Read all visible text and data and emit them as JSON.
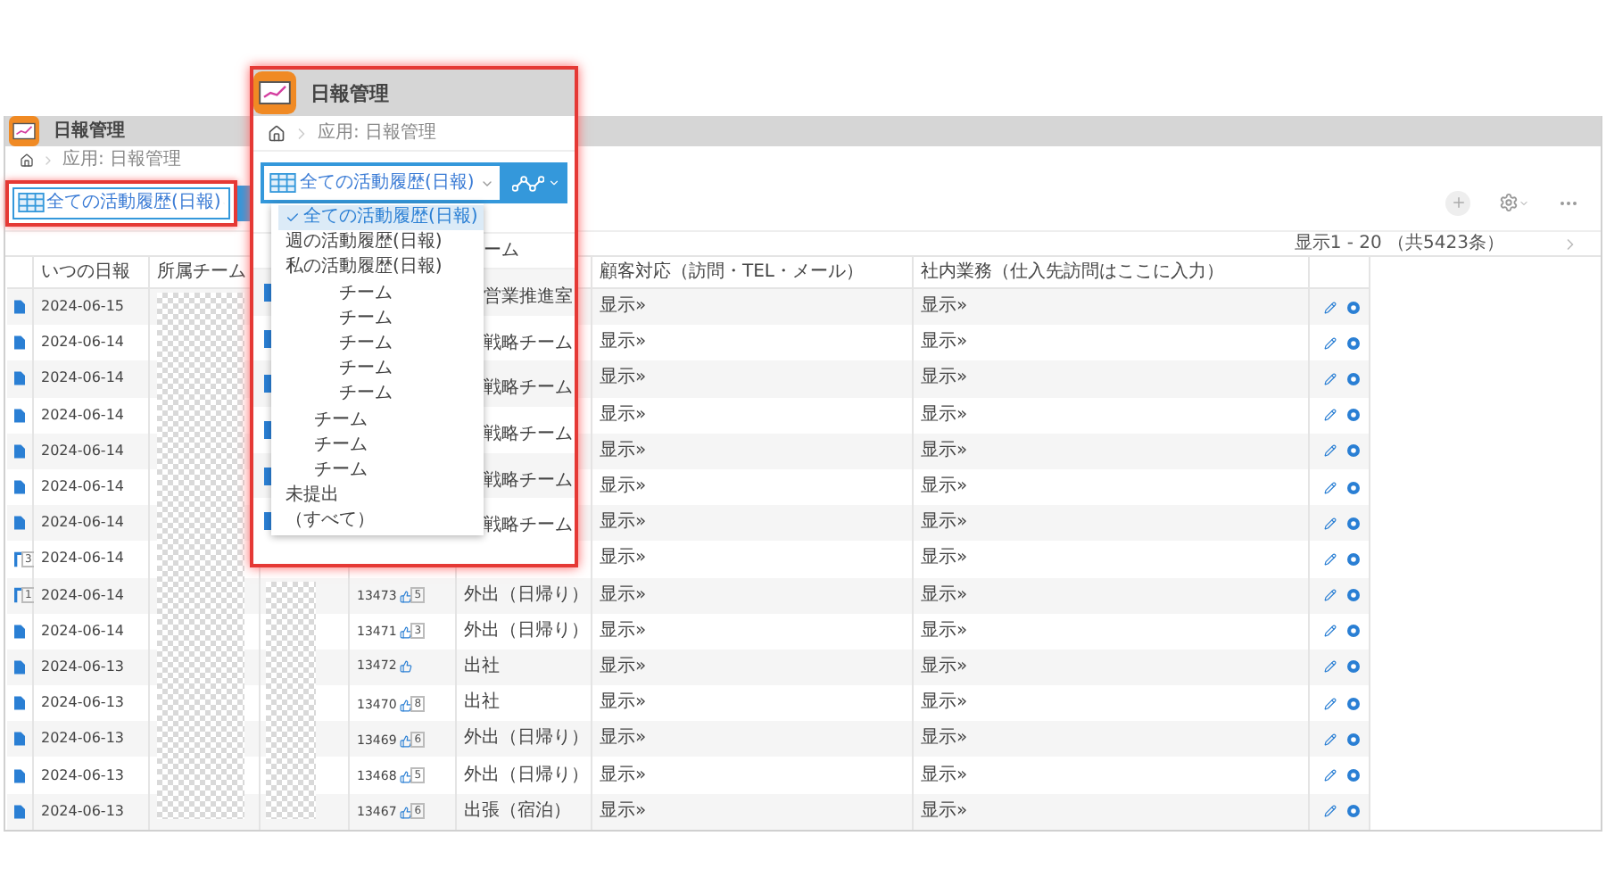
{
  "app": {
    "title": "日報管理",
    "breadcrumb": "应用: 日報管理"
  },
  "view_select": {
    "value": "全ての活動履歴(日報)"
  },
  "pagination": {
    "text": "显示1 - 20 （共5423条）"
  },
  "table": {
    "headings": {
      "date": "いつの日報",
      "team": "所属チーム",
      "customer": "顧客対応（訪問・TEL・メール）",
      "internal": "社内業務（仕入先訪問はここに入力）"
    },
    "rows": [
      {
        "kind": "doc",
        "date": "2024-06-15",
        "customer": "显示»",
        "internal": "显示»"
      },
      {
        "kind": "doc",
        "date": "2024-06-14",
        "customer": "显示»",
        "internal": "显示»"
      },
      {
        "kind": "doc",
        "date": "2024-06-14",
        "customer": "显示»",
        "internal": "显示»"
      },
      {
        "kind": "doc",
        "date": "2024-06-14",
        "customer": "显示»",
        "internal": "显示»"
      },
      {
        "kind": "doc",
        "date": "2024-06-14",
        "customer": "显示»",
        "internal": "显示»"
      },
      {
        "kind": "doc",
        "date": "2024-06-14",
        "customer": "显示»",
        "internal": "显示»"
      },
      {
        "kind": "doc",
        "date": "2024-06-14",
        "customer": "显示»",
        "internal": "显示»"
      },
      {
        "kind": "branch",
        "branch_count": "3",
        "date": "2024-06-14",
        "customer": "显示»",
        "internal": "显示»"
      },
      {
        "kind": "branch",
        "branch_count": "1",
        "date": "2024-06-14",
        "number": "13473",
        "likes": "5",
        "type": "外出（日帰り）",
        "customer": "显示»",
        "internal": "显示»"
      },
      {
        "kind": "doc",
        "date": "2024-06-14",
        "number": "13471",
        "likes": "3",
        "type": "外出（日帰り）",
        "customer": "显示»",
        "internal": "显示»"
      },
      {
        "kind": "doc",
        "date": "2024-06-13",
        "number": "13472",
        "type": "出社",
        "customer": "显示»",
        "internal": "显示»"
      },
      {
        "kind": "doc",
        "date": "2024-06-13",
        "number": "13470",
        "likes": "8",
        "type": "出社",
        "customer": "显示»",
        "internal": "显示»"
      },
      {
        "kind": "doc",
        "date": "2024-06-13",
        "number": "13469",
        "likes": "6",
        "type": "外出（日帰り）",
        "customer": "显示»",
        "internal": "显示»"
      },
      {
        "kind": "doc",
        "date": "2024-06-13",
        "number": "13468",
        "likes": "5",
        "type": "外出（日帰り）",
        "customer": "显示»",
        "internal": "显示»"
      },
      {
        "kind": "doc",
        "date": "2024-06-13",
        "number": "13467",
        "likes": "6",
        "type": "出張（宿泊）",
        "customer": "显示»",
        "internal": "显示»"
      }
    ]
  },
  "callout": {
    "title": "日報管理",
    "breadcrumb": "应用: 日報管理",
    "select": "全ての活動履歴(日報)",
    "column_heading": "ーム",
    "cells": [
      "営業推進室",
      "戦略チーム",
      "戦略チーム",
      "戦略チーム",
      "戦略チーム",
      "戦略チーム"
    ],
    "menu": [
      {
        "kind": "view",
        "label": "全ての活動履歴(日報)",
        "selected": true
      },
      {
        "kind": "view",
        "label": "週の活動履歴(日報)",
        "selected": false
      },
      {
        "kind": "view",
        "label": "私の活動履歴(日報)",
        "selected": false
      },
      {
        "kind": "team_wide",
        "label": "チーム",
        "selected": false
      },
      {
        "kind": "team_wide",
        "label": "チーム",
        "selected": false
      },
      {
        "kind": "team_wide",
        "label": "チーム",
        "selected": false
      },
      {
        "kind": "team_wide",
        "label": "チーム",
        "selected": false
      },
      {
        "kind": "team_wide",
        "label": "チーム",
        "selected": false
      },
      {
        "kind": "team_narrow",
        "label": "チーム",
        "selected": false
      },
      {
        "kind": "team_narrow",
        "label": "チーム",
        "selected": false
      },
      {
        "kind": "team_narrow",
        "label": "チーム",
        "selected": false
      },
      {
        "kind": "view",
        "label": "未提出",
        "selected": false
      },
      {
        "kind": "view",
        "label": "（すべて）",
        "selected": false
      }
    ]
  }
}
